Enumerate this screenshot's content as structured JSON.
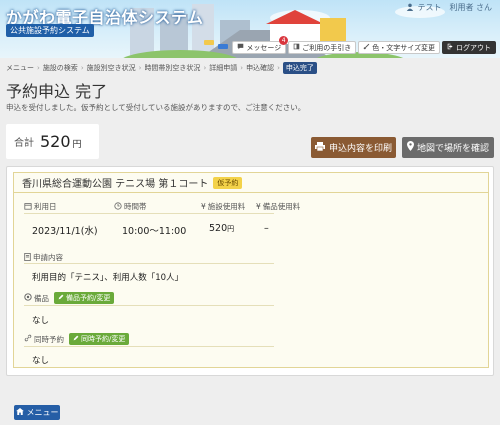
{
  "header": {
    "system_title": "かがわ電子自治体システム",
    "subtitle": "公共施設予約システム",
    "user_name": "テスト　利用者 さん",
    "buttons": {
      "messages": "メッセージ",
      "messages_badge": "4",
      "usage_guide": "ご利用の手引き",
      "display_settings": "色・文字サイズ変更",
      "logout": "ログアウト"
    }
  },
  "breadcrumb": {
    "items": [
      "メニュー",
      "施設の検索",
      "施設別空き状況",
      "時間帯別空き状況",
      "詳細申請",
      "申込確認"
    ],
    "current": "申込完了"
  },
  "page": {
    "title": "予約申込 完了",
    "notice": "申込を受付しました。仮予約として受付している施設がありますので、ご注意ください。"
  },
  "total": {
    "label": "合計",
    "amount": "520",
    "unit": "円"
  },
  "actions": {
    "print": "申込内容を印刷",
    "map": "地図で場所を確認"
  },
  "reservation": {
    "facility": "香川県総合運動公園 テニス場 第１コート",
    "status_tag": "仮予約",
    "date_label": "利用日",
    "date_value": "2023/11/1(水)",
    "time_label": "時間帯",
    "time_value": "10:00〜11:00",
    "facility_fee_label": "施設使用料",
    "facility_fee_value": "520",
    "facility_fee_unit": "円",
    "equipment_fee_label": "備品使用料",
    "equipment_fee_value": "–",
    "application_label": "申請内容",
    "application_value": "利用目的「テニス」、利用人数「10人」",
    "equipment_label": "備品",
    "equipment_button": "備品予約/変更",
    "equipment_value": "なし",
    "simultaneous_label": "同時予約",
    "simultaneous_button": "同時予約/変更",
    "simultaneous_value": "なし"
  },
  "footer": {
    "menu_button": "メニュー"
  }
}
